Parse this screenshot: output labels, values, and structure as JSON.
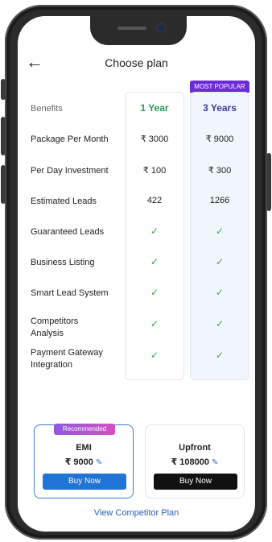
{
  "header": {
    "title": "Choose plan",
    "back_icon": "arrow-left-icon"
  },
  "badge": {
    "popular": "MOST POPULAR"
  },
  "table": {
    "benefits_label": "Benefits",
    "plans": [
      "1 Year",
      "3 Years"
    ],
    "rows": [
      {
        "label": "Package Per Month",
        "v1": "₹ 3000",
        "v2": "₹ 9000"
      },
      {
        "label": "Per Day Investment",
        "v1": "₹ 100",
        "v2": "₹ 300"
      },
      {
        "label": "Estimated Leads",
        "v1": "422",
        "v2": "1266"
      },
      {
        "label": "Guaranteed Leads",
        "v1": "✓",
        "v2": "✓"
      },
      {
        "label": "Business Listing",
        "v1": "✓",
        "v2": "✓"
      },
      {
        "label": "Smart Lead System",
        "v1": "✓",
        "v2": "✓"
      },
      {
        "label": "Competitors Analysis",
        "v1": "✓",
        "v2": "✓"
      },
      {
        "label": "Payment Gateway Integration",
        "v1": "✓",
        "v2": "✓"
      }
    ]
  },
  "cards": {
    "emi": {
      "badge": "Recommended",
      "name": "EMI",
      "price": "₹ 9000",
      "button": "Buy Now"
    },
    "upfront": {
      "name": "Upfront",
      "price": "₹ 108000",
      "button": "Buy Now"
    }
  },
  "footer": {
    "link": "View Competitor Plan"
  },
  "colors": {
    "one_year": "#1f9d57",
    "three_years": "#3b3aa8",
    "popular_badge": "#6c2bd9",
    "buy_blue": "#1f74d6",
    "check": "#2eaa4a"
  }
}
